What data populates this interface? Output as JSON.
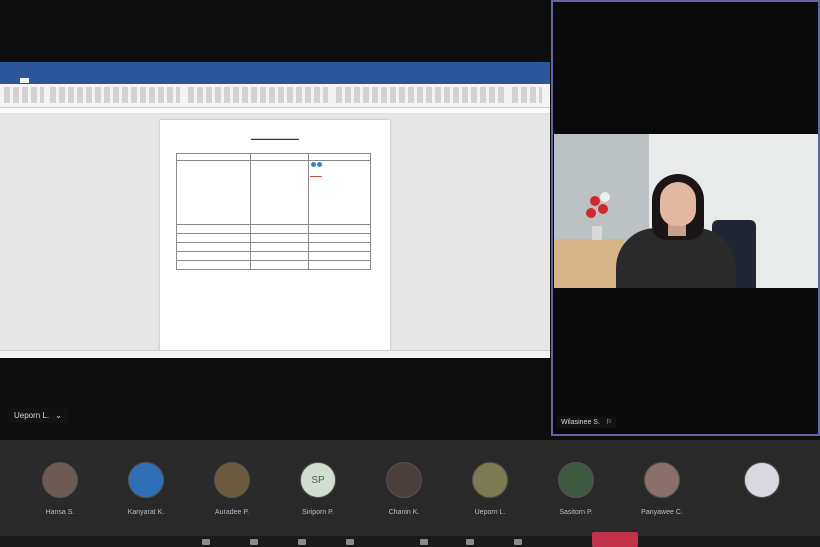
{
  "shared_screen": {
    "app": "Microsoft Word",
    "presenter_tag": "Ueporn L."
  },
  "speaker": {
    "name": "Wilasinee S."
  },
  "participants": [
    {
      "name": "Hansa S.",
      "initials": ""
    },
    {
      "name": "Kanyarat K.",
      "initials": ""
    },
    {
      "name": "Auradee P.",
      "initials": ""
    },
    {
      "name": "Siriporn P.",
      "initials": "SP"
    },
    {
      "name": "Chanin K.",
      "initials": ""
    },
    {
      "name": "Ueporn L.",
      "initials": ""
    },
    {
      "name": "Sasitorn P.",
      "initials": ""
    },
    {
      "name": "Panyawee C.",
      "initials": ""
    },
    {
      "name": "",
      "initials": ""
    }
  ],
  "colors": {
    "word_blue": "#2b579a",
    "active_speaker_border": "#6264a7",
    "hangup_red": "#c4314b"
  }
}
